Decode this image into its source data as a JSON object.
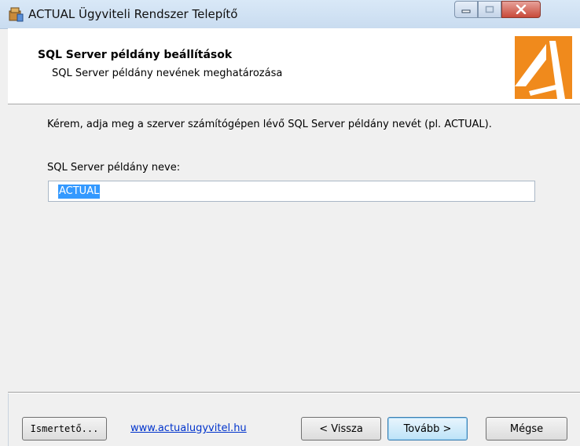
{
  "window": {
    "title": "ACTUAL Ügyviteli Rendszer Telepítő",
    "controls": {
      "minimize_icon": "minimize-icon",
      "maximize_icon": "maximize-icon",
      "close_icon": "close-icon"
    }
  },
  "header": {
    "title": "SQL Server példány beállítások",
    "subtitle": "SQL Server példány nevének meghatározása",
    "logo_color": "#f08a1c"
  },
  "content": {
    "instruction": "Kérem, adja meg a szerver számítógépen lévő SQL Server példány nevét (pl. ACTUAL).",
    "field_label": "SQL Server példány neve:",
    "field_value": "ACTUAL"
  },
  "footer": {
    "readme_label": "Ismertető...",
    "link_text": "www.actualugyvitel.hu",
    "back_label": "< Vissza",
    "next_label": "Tovább >",
    "cancel_label": "Mégse"
  },
  "colors": {
    "selection": "#3399ff",
    "link": "#0033cc"
  }
}
